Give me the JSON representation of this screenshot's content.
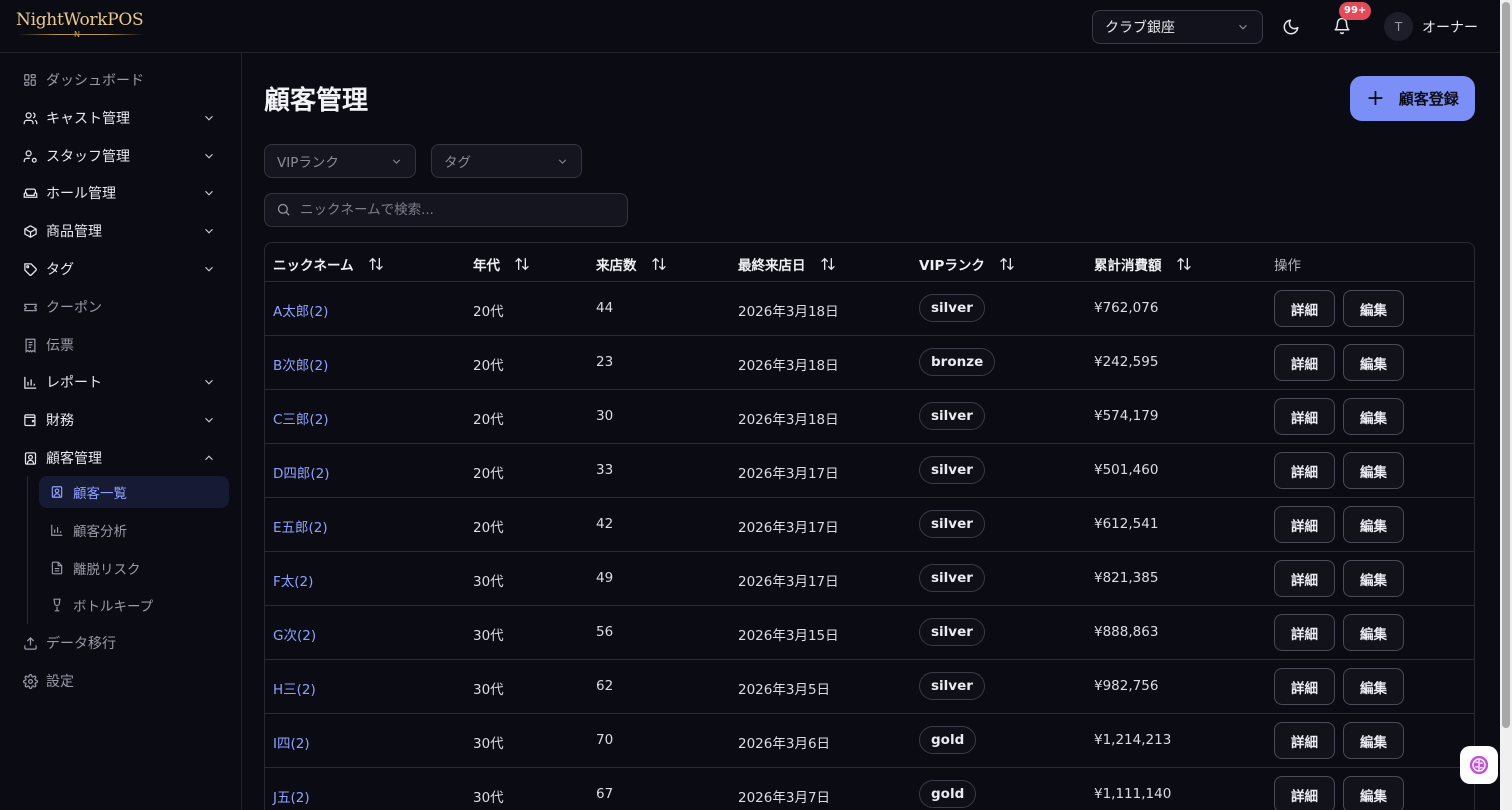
{
  "app": {
    "logo_text": "NightWorkPOS",
    "logo_mini": "N"
  },
  "header": {
    "store": "クラブ銀座",
    "notification_count": "99+",
    "avatar_initial": "T",
    "user_role": "オーナー"
  },
  "sidebar": {
    "items": [
      {
        "label": "ダッシュボード",
        "icon": "dashboard-icon",
        "expandable": false,
        "dim": true
      },
      {
        "label": "キャスト管理",
        "icon": "users-icon",
        "expandable": true,
        "dim": false
      },
      {
        "label": "スタッフ管理",
        "icon": "user-cog-icon",
        "expandable": true,
        "dim": false
      },
      {
        "label": "ホール管理",
        "icon": "sofa-icon",
        "expandable": true,
        "dim": false
      },
      {
        "label": "商品管理",
        "icon": "package-icon",
        "expandable": true,
        "dim": false
      },
      {
        "label": "タグ",
        "icon": "tag-icon",
        "expandable": true,
        "dim": false
      },
      {
        "label": "クーポン",
        "icon": "ticket-icon",
        "expandable": false,
        "dim": true
      },
      {
        "label": "伝票",
        "icon": "receipt-icon",
        "expandable": false,
        "dim": true
      },
      {
        "label": "レポート",
        "icon": "bar-chart-icon",
        "expandable": true,
        "dim": false
      },
      {
        "label": "財務",
        "icon": "wallet-icon",
        "expandable": true,
        "dim": false
      },
      {
        "label": "顧客管理",
        "icon": "contact-icon",
        "expandable": true,
        "dim": false,
        "expanded": true
      }
    ],
    "customer_sub": [
      {
        "label": "顧客一覧",
        "icon": "contact-icon",
        "active": true
      },
      {
        "label": "顧客分析",
        "icon": "bar-chart-icon",
        "active": false
      },
      {
        "label": "離脱リスク",
        "icon": "file-icon",
        "active": false
      },
      {
        "label": "ボトルキープ",
        "icon": "wine-icon",
        "active": false
      }
    ],
    "bottom": [
      {
        "label": "データ移行",
        "icon": "upload-icon"
      },
      {
        "label": "設定",
        "icon": "gear-icon"
      }
    ]
  },
  "main": {
    "title": "顧客管理",
    "add_button": "顧客登録",
    "filters": {
      "vip": "VIPランク",
      "tag": "タグ"
    },
    "search_placeholder": "ニックネームで検索..."
  },
  "table": {
    "columns": [
      "ニックネーム",
      "年代",
      "来店数",
      "最終来店日",
      "VIPランク",
      "累計消費額",
      "操作"
    ],
    "detail_label": "詳細",
    "edit_label": "編集",
    "rows": [
      {
        "name": "A太郎(2)",
        "age": "20代",
        "visits": "44",
        "last": "2026年3月18日",
        "rank": "silver",
        "total": "¥762,076"
      },
      {
        "name": "B次郎(2)",
        "age": "20代",
        "visits": "23",
        "last": "2026年3月18日",
        "rank": "bronze",
        "total": "¥242,595"
      },
      {
        "name": "C三郎(2)",
        "age": "20代",
        "visits": "30",
        "last": "2026年3月18日",
        "rank": "silver",
        "total": "¥574,179"
      },
      {
        "name": "D四郎(2)",
        "age": "20代",
        "visits": "33",
        "last": "2026年3月17日",
        "rank": "silver",
        "total": "¥501,460"
      },
      {
        "name": "E五郎(2)",
        "age": "20代",
        "visits": "42",
        "last": "2026年3月17日",
        "rank": "silver",
        "total": "¥612,541"
      },
      {
        "name": "F太(2)",
        "age": "30代",
        "visits": "49",
        "last": "2026年3月17日",
        "rank": "silver",
        "total": "¥821,385"
      },
      {
        "name": "G次(2)",
        "age": "30代",
        "visits": "56",
        "last": "2026年3月15日",
        "rank": "silver",
        "total": "¥888,863"
      },
      {
        "name": "H三(2)",
        "age": "30代",
        "visits": "62",
        "last": "2026年3月5日",
        "rank": "silver",
        "total": "¥982,756"
      },
      {
        "name": "I四(2)",
        "age": "30代",
        "visits": "70",
        "last": "2026年3月6日",
        "rank": "gold",
        "total": "¥1,214,213"
      },
      {
        "name": "J五(2)",
        "age": "30代",
        "visits": "67",
        "last": "2026年3月7日",
        "rank": "gold",
        "total": "¥1,111,140"
      }
    ]
  },
  "colors": {
    "accent": "#7b8ff7",
    "link": "#8ea1ff",
    "badge": "#e34b5a",
    "logo_gold": "#e9c98a"
  }
}
